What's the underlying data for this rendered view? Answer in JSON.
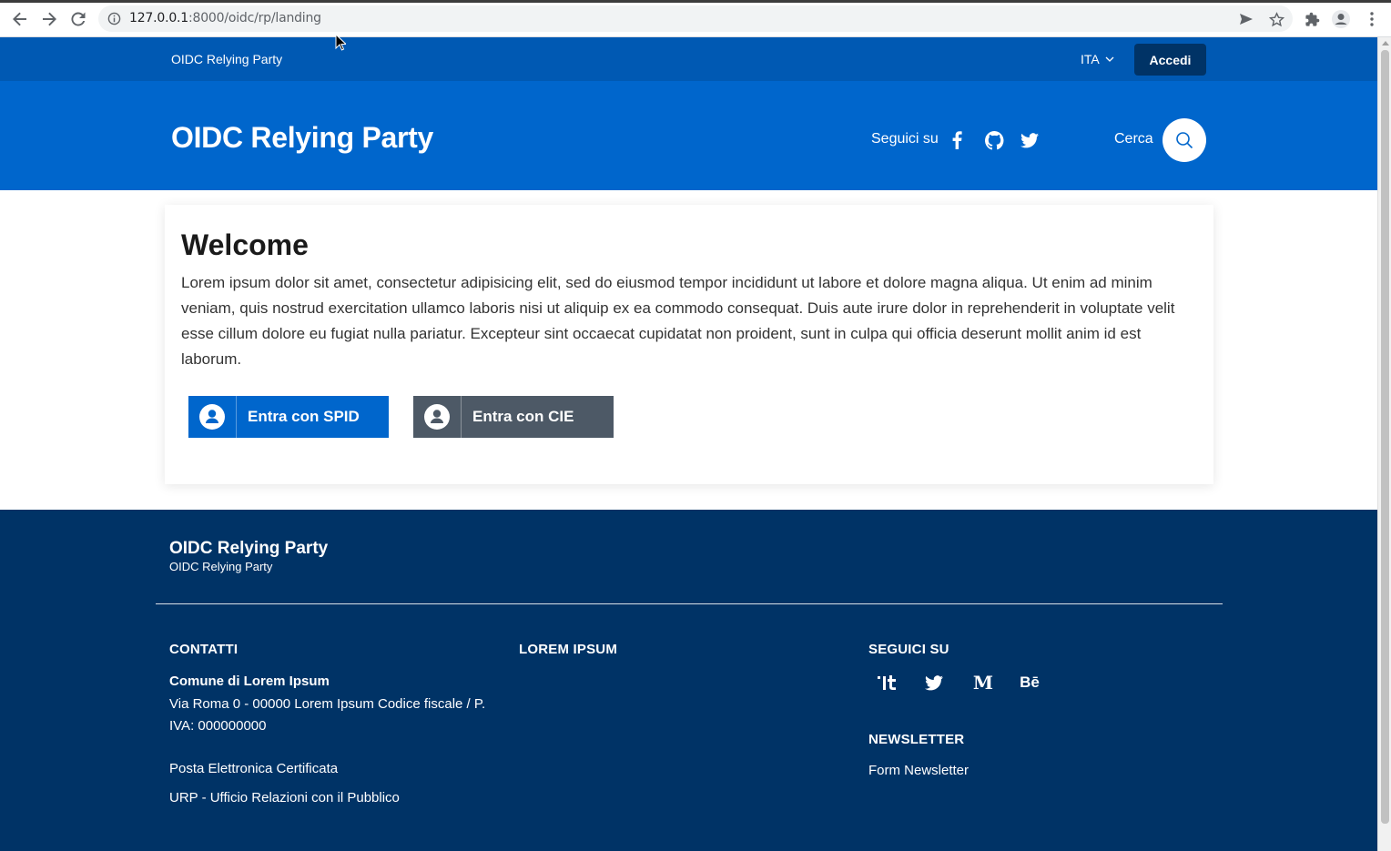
{
  "browser": {
    "url_host": "127.0.0.1",
    "url_rest": ":8000/oidc/rp/landing"
  },
  "slim_header": {
    "brand": "OIDC Relying Party",
    "language": "ITA",
    "login_label": "Accedi"
  },
  "center_header": {
    "title": "OIDC Relying Party",
    "follow_label": "Seguici su",
    "social_icons": [
      "facebook-icon",
      "github-icon",
      "twitter-icon"
    ],
    "search_label": "Cerca"
  },
  "main": {
    "heading": "Welcome",
    "paragraph": "Lorem ipsum dolor sit amet, consectetur adipisicing elit, sed do eiusmod tempor incididunt ut labore et dolore magna aliqua. Ut enim ad minim veniam, quis nostrud exercitation ullamco laboris nisi ut aliquip ex ea commodo consequat. Duis aute irure dolor in reprehenderit in voluptate velit esse cillum dolore eu fugiat nulla pariatur. Excepteur sint occaecat cupidatat non proident, sunt in culpa qui officia deserunt mollit anim id est laborum.",
    "spid_label": "Entra con SPID",
    "cie_label": "Entra con CIE"
  },
  "footer": {
    "brand": "OIDC Relying Party",
    "subtitle": "OIDC Relying Party",
    "contacts_heading": "CONTATTI",
    "org_name": "Comune di Lorem Ipsum",
    "address_line1": "Via Roma 0 - 00000 Lorem Ipsum Codice fiscale / P.",
    "address_line2": "IVA: 000000000",
    "pec_link": "Posta Elettronica Certificata",
    "urp_link": "URP - Ufficio Relazioni con il Pubblico",
    "lorem_heading": "LOREM IPSUM",
    "follow_heading": "SEGUICI SU",
    "social_icons": [
      "designers-italia-icon",
      "twitter-icon",
      "medium-icon",
      "behance-icon"
    ],
    "medium_glyph": "M",
    "behance_glyph": "Bē",
    "newsletter_heading": "NEWSLETTER",
    "newsletter_link": "Form Newsletter"
  },
  "colors": {
    "slim_header": "#0059b3",
    "center_header": "#0066cc",
    "login_button": "#003366",
    "footer": "#003366",
    "cie_button": "#4d5966"
  }
}
